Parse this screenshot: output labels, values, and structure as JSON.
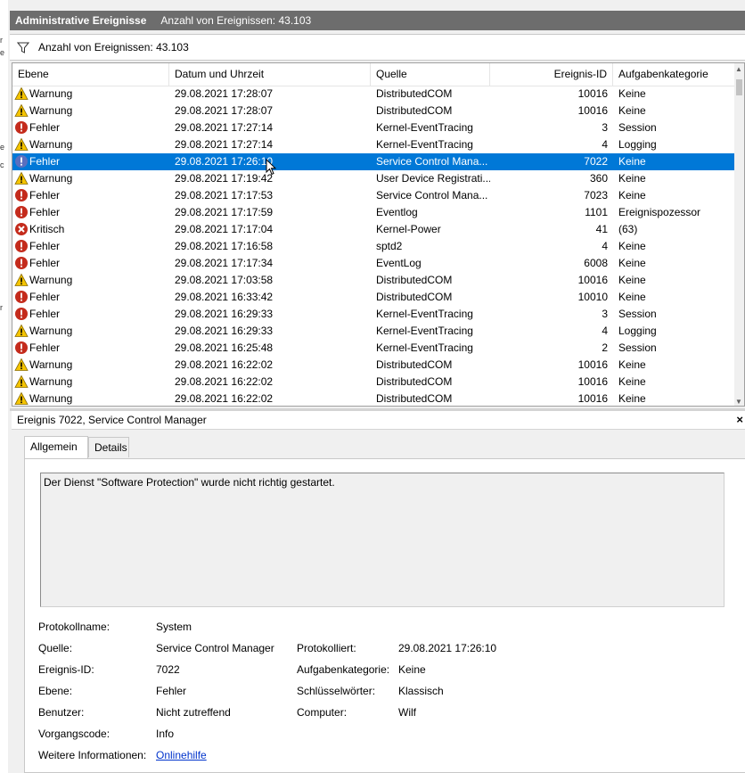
{
  "title_bar": {
    "section": "Administrative Ereignisse",
    "count": "Anzahl von Ereignissen: 43.103"
  },
  "filter_bar": {
    "text": "Anzahl von Ereignissen: 43.103",
    "icon": "filter-icon"
  },
  "columns": {
    "level": "Ebene",
    "date": "Datum und Uhrzeit",
    "source": "Quelle",
    "id": "Ereignis-ID",
    "category": "Aufgabenkategorie"
  },
  "events": [
    {
      "level": "Warnung",
      "icon": "warning",
      "date": "29.08.2021 17:28:07",
      "source": "DistributedCOM",
      "id": "10016",
      "category": "Keine"
    },
    {
      "level": "Warnung",
      "icon": "warning",
      "date": "29.08.2021 17:28:07",
      "source": "DistributedCOM",
      "id": "10016",
      "category": "Keine"
    },
    {
      "level": "Fehler",
      "icon": "error",
      "date": "29.08.2021 17:27:14",
      "source": "Kernel-EventTracing",
      "id": "3",
      "category": "Session"
    },
    {
      "level": "Warnung",
      "icon": "warning",
      "date": "29.08.2021 17:27:14",
      "source": "Kernel-EventTracing",
      "id": "4",
      "category": "Logging"
    },
    {
      "level": "Fehler",
      "icon": "error-selected",
      "date": "29.08.2021 17:26:10",
      "source": "Service Control Mana...",
      "id": "7022",
      "category": "Keine",
      "selected": true
    },
    {
      "level": "Warnung",
      "icon": "warning",
      "date": "29.08.2021 17:19:42",
      "source": "User Device Registrati...",
      "id": "360",
      "category": "Keine"
    },
    {
      "level": "Fehler",
      "icon": "error",
      "date": "29.08.2021 17:17:53",
      "source": "Service Control Mana...",
      "id": "7023",
      "category": "Keine"
    },
    {
      "level": "Fehler",
      "icon": "error",
      "date": "29.08.2021 17:17:59",
      "source": "Eventlog",
      "id": "1101",
      "category": "Ereignispozessor"
    },
    {
      "level": "Kritisch",
      "icon": "critical",
      "date": "29.08.2021 17:17:04",
      "source": "Kernel-Power",
      "id": "41",
      "category": "(63)"
    },
    {
      "level": "Fehler",
      "icon": "error",
      "date": "29.08.2021 17:16:58",
      "source": "sptd2",
      "id": "4",
      "category": "Keine"
    },
    {
      "level": "Fehler",
      "icon": "error",
      "date": "29.08.2021 17:17:34",
      "source": "EventLog",
      "id": "6008",
      "category": "Keine"
    },
    {
      "level": "Warnung",
      "icon": "warning",
      "date": "29.08.2021 17:03:58",
      "source": "DistributedCOM",
      "id": "10016",
      "category": "Keine"
    },
    {
      "level": "Fehler",
      "icon": "error",
      "date": "29.08.2021 16:33:42",
      "source": "DistributedCOM",
      "id": "10010",
      "category": "Keine"
    },
    {
      "level": "Fehler",
      "icon": "error",
      "date": "29.08.2021 16:29:33",
      "source": "Kernel-EventTracing",
      "id": "3",
      "category": "Session"
    },
    {
      "level": "Warnung",
      "icon": "warning",
      "date": "29.08.2021 16:29:33",
      "source": "Kernel-EventTracing",
      "id": "4",
      "category": "Logging"
    },
    {
      "level": "Fehler",
      "icon": "error",
      "date": "29.08.2021 16:25:48",
      "source": "Kernel-EventTracing",
      "id": "2",
      "category": "Session"
    },
    {
      "level": "Warnung",
      "icon": "warning",
      "date": "29.08.2021 16:22:02",
      "source": "DistributedCOM",
      "id": "10016",
      "category": "Keine"
    },
    {
      "level": "Warnung",
      "icon": "warning",
      "date": "29.08.2021 16:22:02",
      "source": "DistributedCOM",
      "id": "10016",
      "category": "Keine"
    },
    {
      "level": "Warnung",
      "icon": "warning",
      "date": "29.08.2021 16:22:02",
      "source": "DistributedCOM",
      "id": "10016",
      "category": "Keine"
    }
  ],
  "detail": {
    "title": "Ereignis 7022, Service Control Manager",
    "close": "×",
    "tabs": [
      "Allgemein",
      "Details"
    ],
    "message": "Der Dienst \"Software Protection\" wurde nicht richtig gestartet.",
    "properties": {
      "protokollname_label": "Protokollname:",
      "protokollname": "System",
      "quelle_label": "Quelle:",
      "quelle": "Service Control Manager",
      "protokolliert_label": "Protokolliert:",
      "protokolliert": "29.08.2021 17:26:10",
      "ereignis_id_label": "Ereignis-ID:",
      "ereignis_id": "7022",
      "aufgabenkategorie_label": "Aufgabenkategorie:",
      "aufgabenkategorie": "Keine",
      "ebene_label": "Ebene:",
      "ebene": "Fehler",
      "schluesselwoerter_label": "Schlüsselwörter:",
      "schluesselwoerter": "Klassisch",
      "benutzer_label": "Benutzer:",
      "benutzer": "Nicht zutreffend",
      "computer_label": "Computer:",
      "computer": "Wilf",
      "vorgangscode_label": "Vorgangscode:",
      "vorgangscode": "Info",
      "weitere_label": "Weitere Informationen:",
      "weitere_link": "Onlinehilfe"
    }
  },
  "colors": {
    "selection": "#0078d7",
    "title_bar": "#6d6d6d",
    "error": "#c42b1c",
    "warning": "#f5c400",
    "link": "#0033cc"
  }
}
